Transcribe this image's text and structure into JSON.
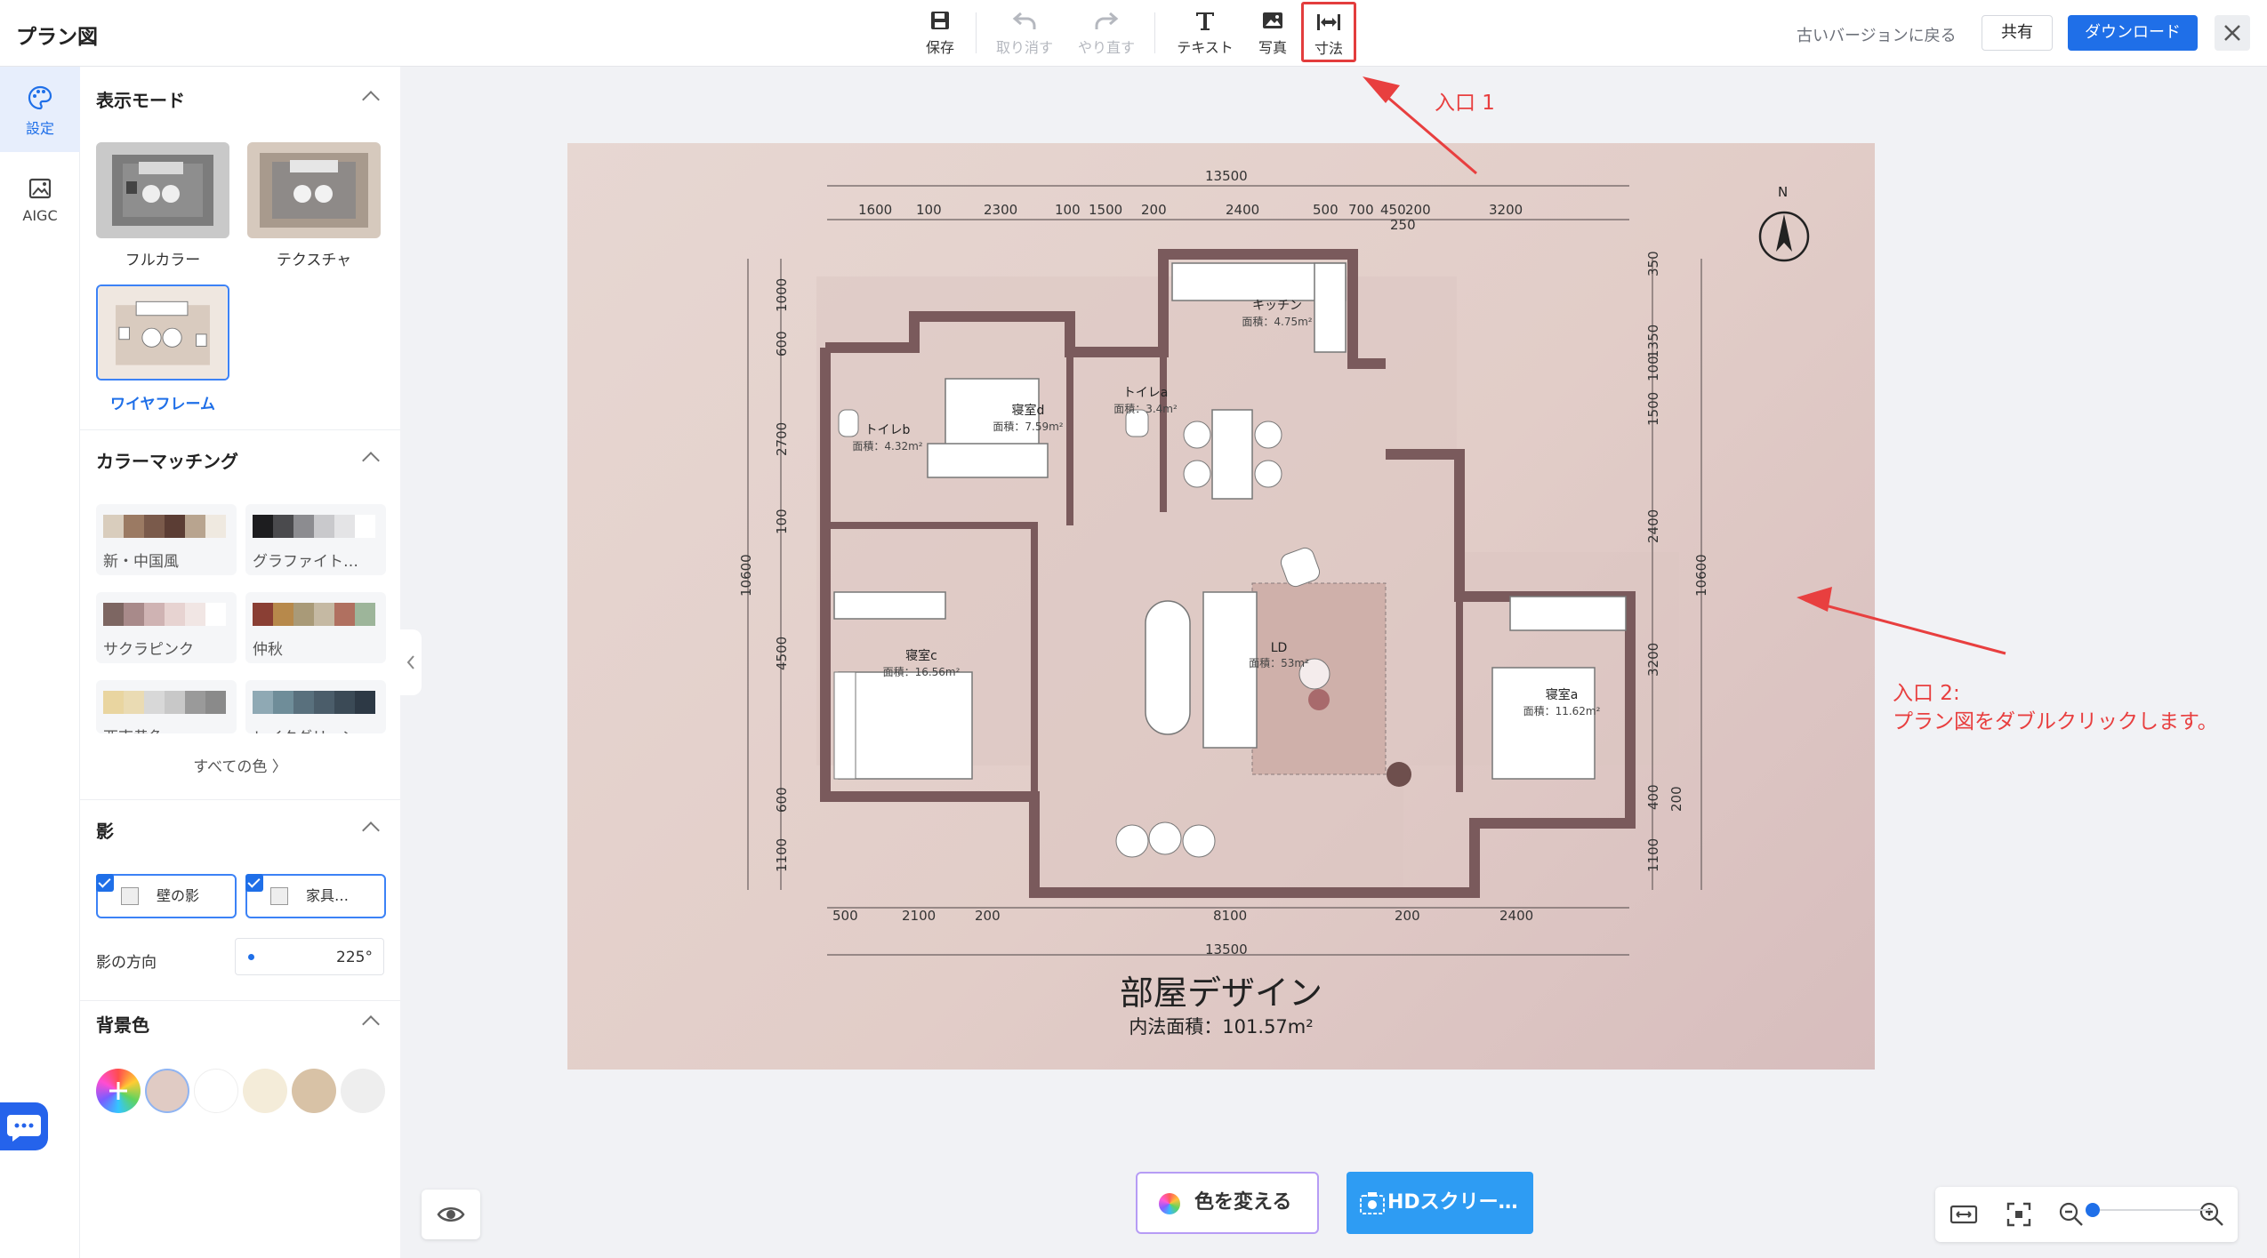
{
  "app": {
    "title": "プラン図"
  },
  "toolbar": {
    "save": "保存",
    "undo": "取り消す",
    "redo": "やり直す",
    "text": "テキスト",
    "photo": "写真",
    "dimension": "寸法"
  },
  "header": {
    "revert": "古いバージョンに戻る",
    "share": "共有",
    "download": "ダウンロード"
  },
  "rail": {
    "settings": "設定",
    "aigc": "AIGC"
  },
  "display_mode": {
    "title": "表示モード",
    "modes": [
      "フルカラー",
      "テクスチャ",
      "ワイヤフレーム"
    ],
    "selected": "ワイヤフレーム"
  },
  "color_matching": {
    "title": "カラーマッチング",
    "palettes": [
      {
        "name": "新・中国風",
        "colors": [
          "#d9cdbd",
          "#9b7a63",
          "#7a5a4b",
          "#5b3d34",
          "#b8a48f",
          "#efe9e0"
        ]
      },
      {
        "name": "グラファイト…",
        "colors": [
          "#1d1d1f",
          "#4a4a4d",
          "#8c8c90",
          "#c9c9cc",
          "#e4e4e6",
          "#ffffff"
        ]
      },
      {
        "name": "サクラピンク",
        "colors": [
          "#7d6662",
          "#a88a8a",
          "#cfb3b3",
          "#e7d3d1",
          "#f1e6e4",
          "#ffffff"
        ]
      },
      {
        "name": "仲秋",
        "colors": [
          "#8a3f34",
          "#b7894b",
          "#a99a78",
          "#c5b9a3",
          "#b07060",
          "#9db59a"
        ]
      },
      {
        "name": "西南黄色",
        "colors": [
          "#e9d5a0",
          "#eadbb3",
          "#d8d8d8",
          "#c8c8c8",
          "#9a9a9a",
          "#8a8a8a"
        ]
      },
      {
        "name": "レイクグリーン",
        "colors": [
          "#8fa9b4",
          "#6f8d99",
          "#59707d",
          "#4b5d6a",
          "#3b4a56",
          "#2d3945"
        ]
      }
    ],
    "all_colors": "すべての色 〉"
  },
  "shadow": {
    "title": "影",
    "wall_shadow": "壁の影",
    "furniture_shadow": "家具…",
    "direction_label": "影の方向",
    "direction_value": "225°"
  },
  "background": {
    "title": "背景色",
    "swatches": [
      "#e0cbc4",
      "#ffffff",
      "#f4ecd9",
      "#d8c2a6",
      "#eeeeee"
    ]
  },
  "plan": {
    "title": "部屋デザイン",
    "area": "内法面積：101.57m²",
    "north": "N",
    "top_total": "13500",
    "top_dims": [
      "1600",
      "100",
      "2300",
      "100",
      "1500",
      "200",
      "2400",
      "500",
      "700",
      "450",
      "200",
      "3200"
    ],
    "top_sub": "250",
    "bottom_dims": [
      "500",
      "2100",
      "200",
      "8100",
      "200",
      "2400"
    ],
    "bottom_total": "13500",
    "left_total": "10600",
    "left_dims": [
      "1000",
      "600",
      "2700",
      "100",
      "4500",
      "600",
      "1100"
    ],
    "right_total": "10600",
    "right_dims": [
      "350",
      "1350",
      "100",
      "1500",
      "2400",
      "3200",
      "400",
      "200",
      "1100"
    ],
    "rooms": [
      {
        "name": "キッチン",
        "area": "面積：4.75m²"
      },
      {
        "name": "寝室d",
        "area": "面積：7.59m²"
      },
      {
        "name": "トイレa",
        "area": "面積：3.4m²"
      },
      {
        "name": "トイレb",
        "area": "面積：4.32m²"
      },
      {
        "name": "寝室c",
        "area": "面積：16.56m²"
      },
      {
        "name": "LD",
        "area": "面積：53m²"
      },
      {
        "name": "寝室a",
        "area": "面積：11.62m²"
      }
    ]
  },
  "annotations": {
    "entry1": "入口 1",
    "entry2_line1": "入口 2:",
    "entry2_line2": "プラン図をダブルクリックします。"
  },
  "bottom": {
    "change_color": "色を変える",
    "hd_screenshot": "HDスクリー…"
  }
}
